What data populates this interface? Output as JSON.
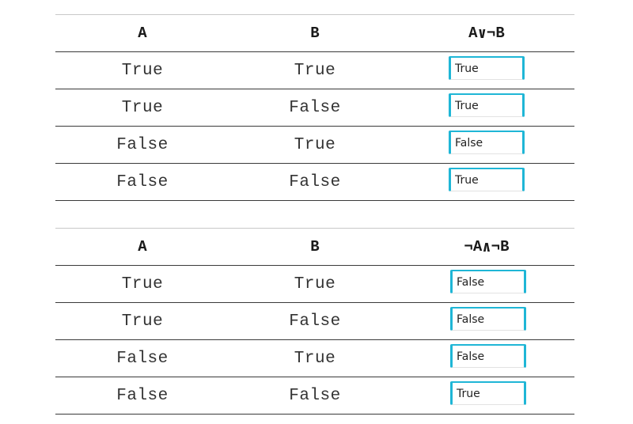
{
  "tables": [
    {
      "header": {
        "a": "A",
        "b": "B",
        "expr_left": "A",
        "operator": "∨",
        "expr_right": "¬B"
      },
      "rows": [
        {
          "a": "True",
          "b": "True",
          "answer": "True"
        },
        {
          "a": "True",
          "b": "False",
          "answer": "True"
        },
        {
          "a": "False",
          "b": "True",
          "answer": "False"
        },
        {
          "a": "False",
          "b": "False",
          "answer": "True"
        }
      ]
    },
    {
      "header": {
        "a": "A",
        "b": "B",
        "expr_left": "¬A",
        "operator": "∧",
        "expr_right": "¬B"
      },
      "rows": [
        {
          "a": "True",
          "b": "True",
          "answer": "False"
        },
        {
          "a": "True",
          "b": "False",
          "answer": "False"
        },
        {
          "a": "False",
          "b": "True",
          "answer": "False"
        },
        {
          "a": "False",
          "b": "False",
          "answer": "True"
        }
      ]
    }
  ],
  "colors": {
    "input_accent": "#1fb6d6",
    "row_rule": "#3a3a3a",
    "top_rule": "#c8c8c8"
  }
}
